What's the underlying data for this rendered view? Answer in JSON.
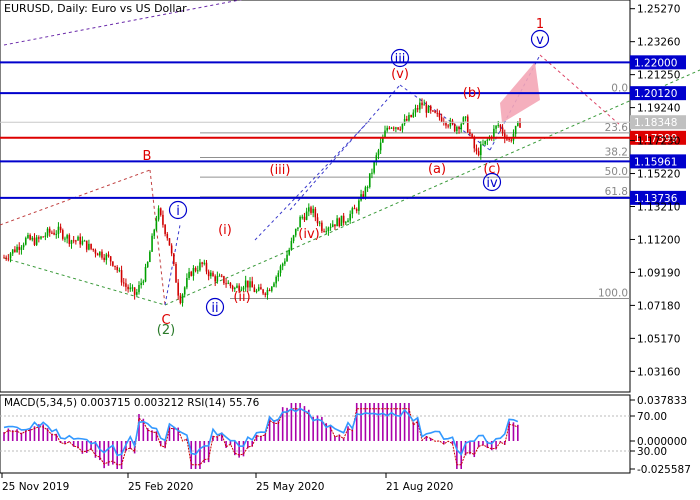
{
  "header": {
    "symbol": "EURUSD",
    "timeframe": "Daily",
    "description": "Euro vs US Dollar",
    "title": "EURUSD, Daily:  Euro vs US Dollar"
  },
  "indicator": {
    "title": "MACD(5,34,5) 0.003715 0.003212 RSI(14) 55.76"
  },
  "colors": {
    "background": "#ffffff",
    "candle_up": "#00a000",
    "candle_down": "#d00000",
    "level_line": "#0000cc",
    "current_price_line": "#dd0000",
    "fib_line": "#909090",
    "wave_red": "#dd0000",
    "wave_blue": "#0000cc",
    "wave_green": "#2a7a2a",
    "macd_hist": "#aa00aa",
    "macd_signal": "#cc0000",
    "rsi": "#3399ff",
    "target_zone": "#f4a6b6"
  },
  "chart_data": [
    {
      "type": "candlestick",
      "instrument": "EURUSD",
      "timeframe": "Daily",
      "x_ticks": [
        "25 Nov 2019",
        "25 Feb 2020",
        "25 May 2020",
        "21 Aug 2020"
      ],
      "y_ticks": [
        "1.25270",
        "1.23260",
        "1.21250",
        "1.19240",
        "1.17230",
        "1.15220",
        "1.13210",
        "1.11200",
        "1.09190",
        "1.07180",
        "1.05170",
        "1.03160"
      ],
      "ylim": [
        1.019,
        1.258
      ],
      "levels": [
        {
          "value": 1.22,
          "label": "1.22000",
          "kind": "resistance"
        },
        {
          "value": 1.2012,
          "label": "1.20120",
          "kind": "resistance"
        },
        {
          "value": 1.18348,
          "label": "1.18348",
          "kind": "current"
        },
        {
          "value": 1.17399,
          "label": "1.17399",
          "kind": "pivot"
        },
        {
          "value": 1.15961,
          "label": "1.15961",
          "kind": "support"
        },
        {
          "value": 1.13736,
          "label": "1.13736",
          "kind": "support"
        }
      ],
      "fibonacci": [
        {
          "label": "0.0",
          "value": 1.201
        },
        {
          "label": "23.6",
          "value": 1.177
        },
        {
          "label": "38.2",
          "value": 1.162
        },
        {
          "label": "50.0",
          "value": 1.15
        },
        {
          "label": "61.8",
          "value": 1.138
        },
        {
          "label": "100.0",
          "value": 1.076
        }
      ],
      "wave_labels": [
        "1",
        "v",
        "iii",
        "(v)",
        "(b)",
        "(a)",
        "(c)",
        "iv",
        "B",
        "i",
        "(i)",
        "(iii)",
        "(iv)",
        "(ii)",
        "ii",
        "C",
        "(2)"
      ],
      "series": [
        {
          "kind": "ohlc_close",
          "x": [
            "2019-11-25",
            "2019-12-02",
            "2019-12-09",
            "2019-12-16",
            "2019-12-23",
            "2019-12-30",
            "2020-01-06",
            "2020-01-13",
            "2020-01-20",
            "2020-01-27",
            "2020-02-03",
            "2020-02-10",
            "2020-02-17",
            "2020-02-24",
            "2020-03-02",
            "2020-03-09",
            "2020-03-16",
            "2020-03-23",
            "2020-03-30",
            "2020-04-06",
            "2020-04-13",
            "2020-04-20",
            "2020-04-27",
            "2020-05-04",
            "2020-05-11",
            "2020-05-18",
            "2020-05-25",
            "2020-06-01",
            "2020-06-08",
            "2020-06-15",
            "2020-06-22",
            "2020-06-29",
            "2020-07-06",
            "2020-07-13",
            "2020-07-20",
            "2020-07-27",
            "2020-08-03",
            "2020-08-10",
            "2020-08-17",
            "2020-08-24",
            "2020-08-31",
            "2020-09-07",
            "2020-09-14",
            "2020-09-21",
            "2020-09-28",
            "2020-10-05",
            "2020-10-12",
            "2020-10-19"
          ],
          "y": [
            1.101,
            1.106,
            1.112,
            1.111,
            1.116,
            1.117,
            1.112,
            1.111,
            1.106,
            1.103,
            1.098,
            1.084,
            1.078,
            1.094,
            1.13,
            1.112,
            1.075,
            1.092,
            1.097,
            1.089,
            1.087,
            1.082,
            1.086,
            1.08,
            1.081,
            1.092,
            1.106,
            1.125,
            1.13,
            1.119,
            1.122,
            1.124,
            1.13,
            1.143,
            1.164,
            1.182,
            1.181,
            1.186,
            1.195,
            1.188,
            1.186,
            1.18,
            1.185,
            1.164,
            1.172,
            1.182,
            1.172,
            1.183
          ]
        }
      ]
    },
    {
      "type": "line",
      "indicator": "MACD(5,34,5) / RSI(14)",
      "macd_value": 0.003715,
      "macd_signal": 0.003212,
      "rsi_value": 55.76,
      "y_ticks": [
        "0.037833",
        "70.00",
        "0.000000",
        "30.00",
        "-0.025587"
      ]
    }
  ]
}
